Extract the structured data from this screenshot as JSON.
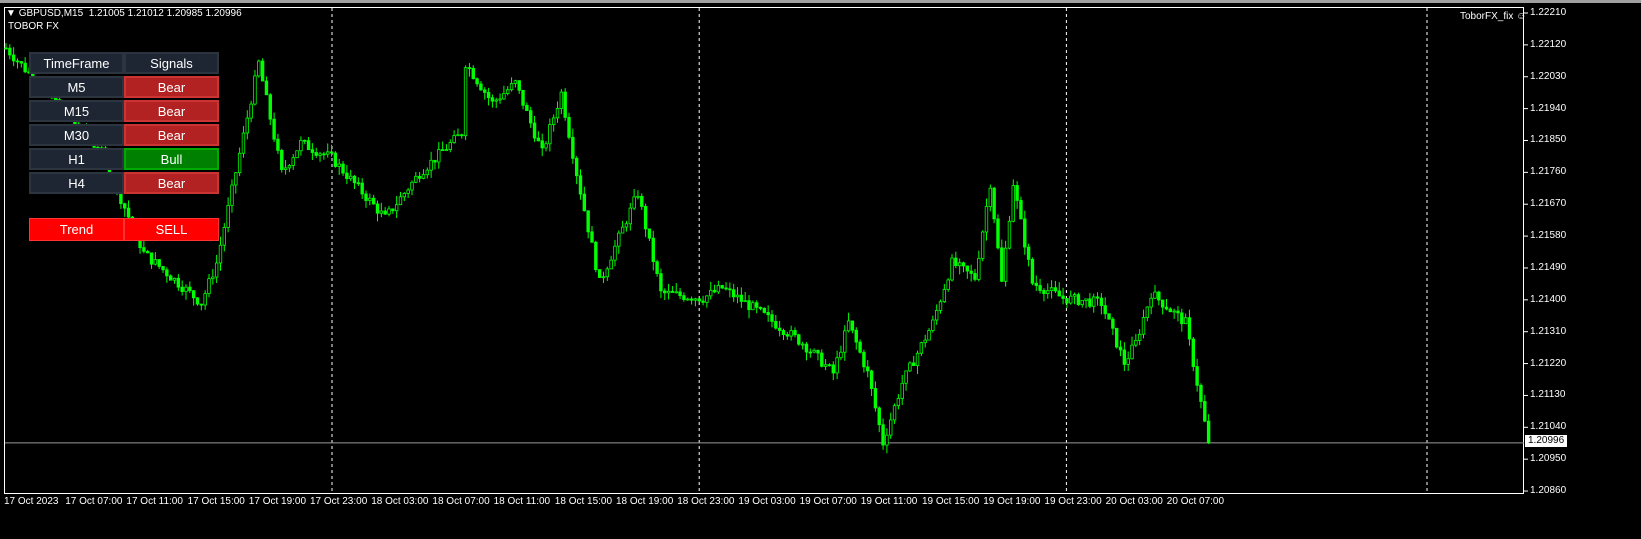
{
  "header": {
    "symbol": "GBPUSD,M15",
    "quote": "1.21005 1.21012 1.20985 1.20996",
    "indicator": "TOBOR FX",
    "expert": "ToborFX_fix"
  },
  "panel": {
    "headers": [
      "TimeFrame",
      "Signals"
    ],
    "rows": [
      {
        "tf": "M5",
        "signal": "Bear"
      },
      {
        "tf": "M15",
        "signal": "Bear"
      },
      {
        "tf": "M30",
        "signal": "Bear"
      },
      {
        "tf": "H1",
        "signal": "Bull"
      },
      {
        "tf": "H4",
        "signal": "Bear"
      }
    ],
    "trend_label": "Trend",
    "trend_value": "SELL"
  },
  "colors": {
    "bear": "#b22222",
    "bull": "#008000",
    "sell": "#ff0000",
    "candle": "#00ff00"
  },
  "chart_data": {
    "type": "candlestick",
    "symbol": "GBPUSD",
    "timeframe": "M15",
    "ylim": [
      1.2086,
      1.2221
    ],
    "price_ticks": [
      "1.22210",
      "1.22120",
      "1.22030",
      "1.21940",
      "1.21850",
      "1.21760",
      "1.21670",
      "1.21580",
      "1.21490",
      "1.21400",
      "1.21310",
      "1.21220",
      "1.21130",
      "1.21040",
      "1.20950",
      "1.20860"
    ],
    "current_price": "1.20996",
    "time_ticks": [
      "17 Oct 2023",
      "17 Oct 07:00",
      "17 Oct 11:00",
      "17 Oct 15:00",
      "17 Oct 19:00",
      "17 Oct 23:00",
      "18 Oct 03:00",
      "18 Oct 07:00",
      "18 Oct 11:00",
      "18 Oct 15:00",
      "18 Oct 19:00",
      "18 Oct 23:00",
      "19 Oct 03:00",
      "19 Oct 07:00",
      "19 Oct 11:00",
      "19 Oct 15:00",
      "19 Oct 19:00",
      "19 Oct 23:00",
      "20 Oct 03:00",
      "20 Oct 07:00"
    ],
    "close_path": [
      [
        0,
        1.22111
      ],
      [
        25,
        1.21815
      ],
      [
        36,
        1.21532
      ],
      [
        51,
        1.21391
      ],
      [
        55,
        1.21504
      ],
      [
        66,
        1.22069
      ],
      [
        72,
        1.21758
      ],
      [
        77,
        1.21843
      ],
      [
        85,
        1.21801
      ],
      [
        99,
        1.21631
      ],
      [
        108,
        1.21758
      ],
      [
        119,
        1.21871
      ],
      [
        120,
        1.22069
      ],
      [
        127,
        1.21956
      ],
      [
        133,
        1.22012
      ],
      [
        140,
        1.21815
      ],
      [
        145,
        1.21984
      ],
      [
        149,
        1.21758
      ],
      [
        155,
        1.21448
      ],
      [
        165,
        1.21702
      ],
      [
        171,
        1.21419
      ],
      [
        182,
        1.21405
      ],
      [
        187,
        1.21434
      ],
      [
        197,
        1.21363
      ],
      [
        208,
        1.21278
      ],
      [
        216,
        1.21193
      ],
      [
        220,
        1.21335
      ],
      [
        225,
        1.21193
      ],
      [
        229,
        1.20996
      ],
      [
        234,
        1.21165
      ],
      [
        242,
        1.21335
      ],
      [
        247,
        1.21504
      ],
      [
        253,
        1.21462
      ],
      [
        257,
        1.2173
      ],
      [
        260,
        1.21448
      ],
      [
        263,
        1.2173
      ],
      [
        268,
        1.21448
      ],
      [
        276,
        1.21405
      ],
      [
        286,
        1.21391
      ],
      [
        292,
        1.21222
      ],
      [
        295,
        1.21278
      ],
      [
        299,
        1.21419
      ],
      [
        305,
        1.21363
      ],
      [
        308,
        1.21335
      ],
      [
        312,
        1.21109
      ],
      [
        314,
        1.20996
      ]
    ]
  }
}
